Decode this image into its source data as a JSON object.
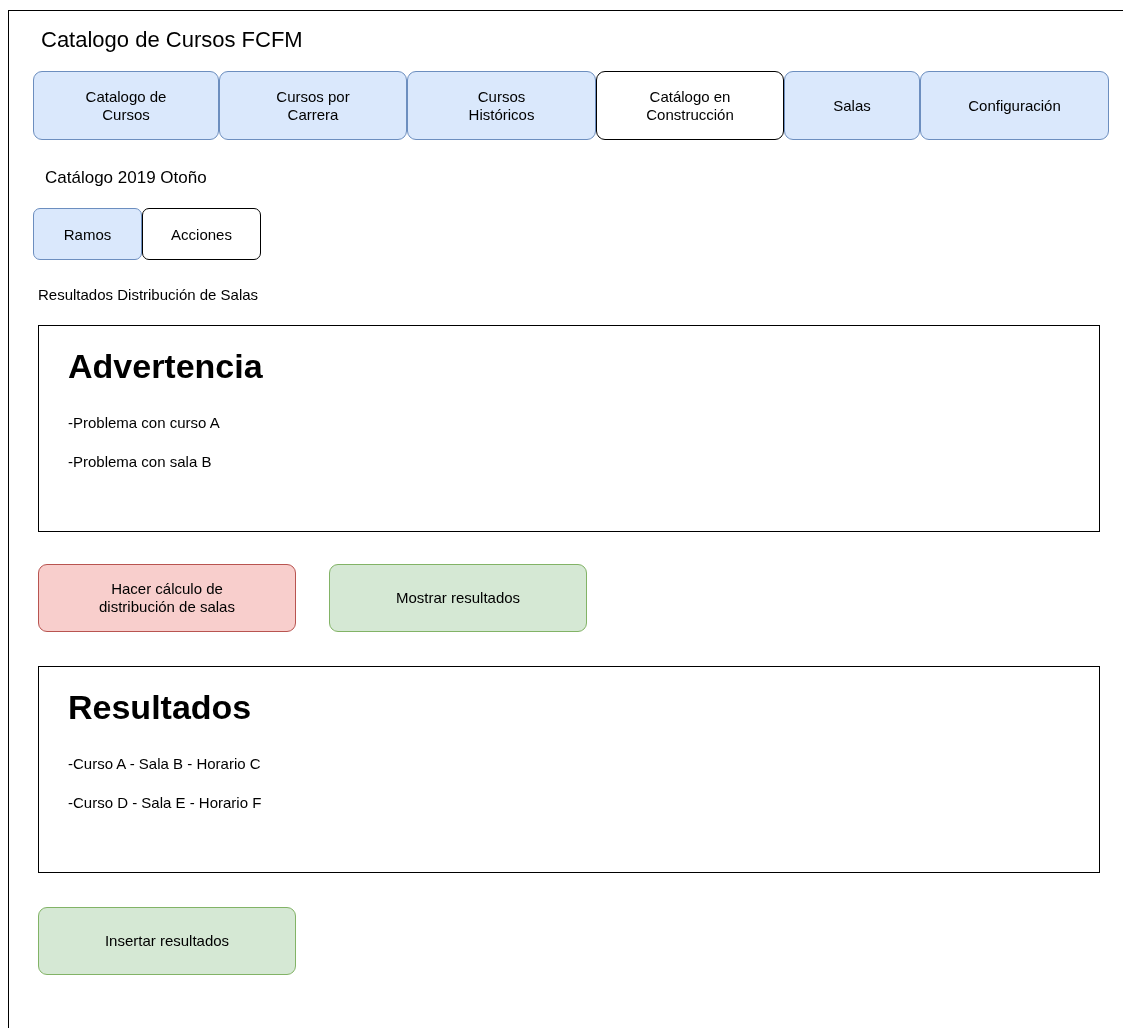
{
  "window": {
    "title": "Catalogo de Cursos FCFM"
  },
  "tabs": [
    {
      "label": "Catalogo de\nCursos",
      "selected": false
    },
    {
      "label": "Cursos por\nCarrera",
      "selected": false
    },
    {
      "label": "Cursos\nHistóricos",
      "selected": false
    },
    {
      "label": "Catálogo en\nConstrucción",
      "selected": true
    },
    {
      "label": "Salas",
      "selected": false
    },
    {
      "label": "Configuración",
      "selected": false
    }
  ],
  "catalog_title": "Catálogo 2019 Otoño",
  "subtabs": [
    {
      "label": "Ramos",
      "selected": false
    },
    {
      "label": "Acciones",
      "selected": true
    }
  ],
  "section_title": "Resultados Distribución de Salas",
  "warning_panel": {
    "heading": "Advertencia",
    "items": [
      "-Problema con curso A",
      "-Problema con sala B"
    ]
  },
  "actions": [
    {
      "label": "Hacer cálculo de\ndistribución de salas",
      "kind": "danger"
    },
    {
      "label": "Mostrar resultados",
      "kind": "success"
    }
  ],
  "results_panel": {
    "heading": "Resultados",
    "items": [
      "-Curso A - Sala B - Horario C",
      "-Curso D - Sala E - Horario F"
    ]
  },
  "insert_button": {
    "label": "Insertar resultados",
    "kind": "success"
  }
}
